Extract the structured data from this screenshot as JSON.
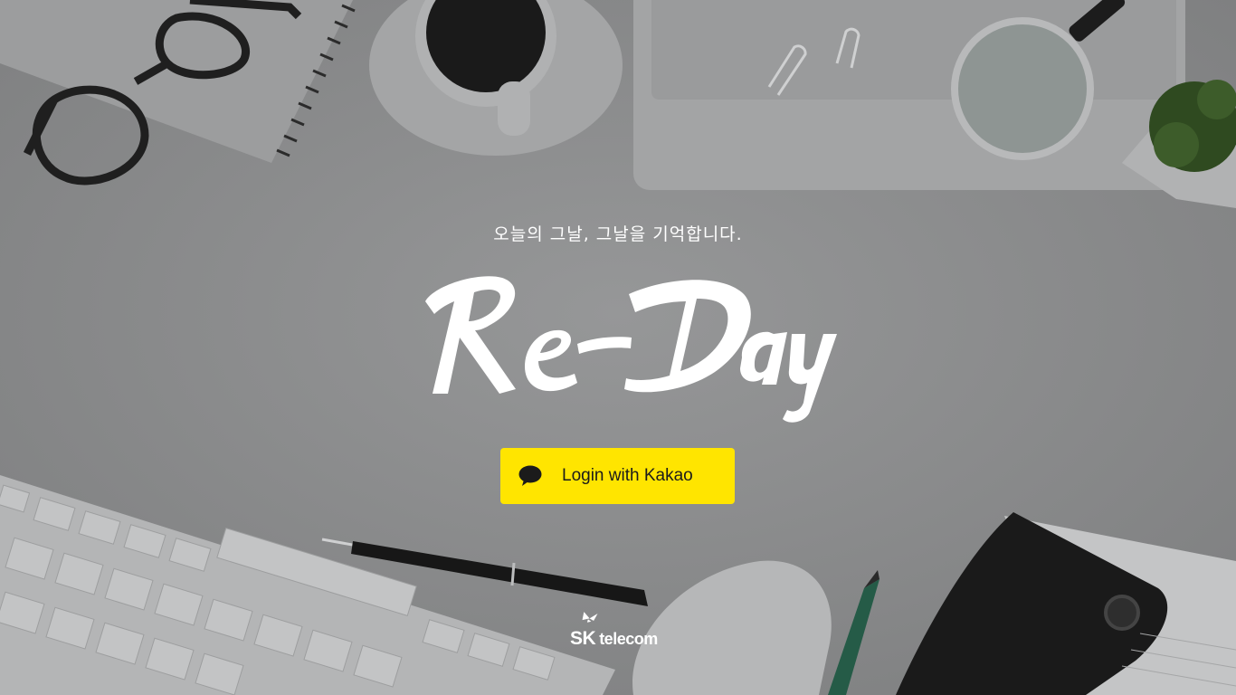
{
  "tagline": "오늘의 그날, 그날을 기억합니다.",
  "logo_text": "Re-Day",
  "login_button": {
    "label": "Login with Kakao",
    "icon": "speech-bubble-icon",
    "color": "#ffe500"
  },
  "footer": {
    "brand_sk": "SK",
    "brand_telecom": "telecom",
    "icon": "butterfly-icon"
  },
  "colors": {
    "overlay": "#8d8e8f",
    "text": "#ffffff",
    "button_text": "#1b1b1b"
  }
}
